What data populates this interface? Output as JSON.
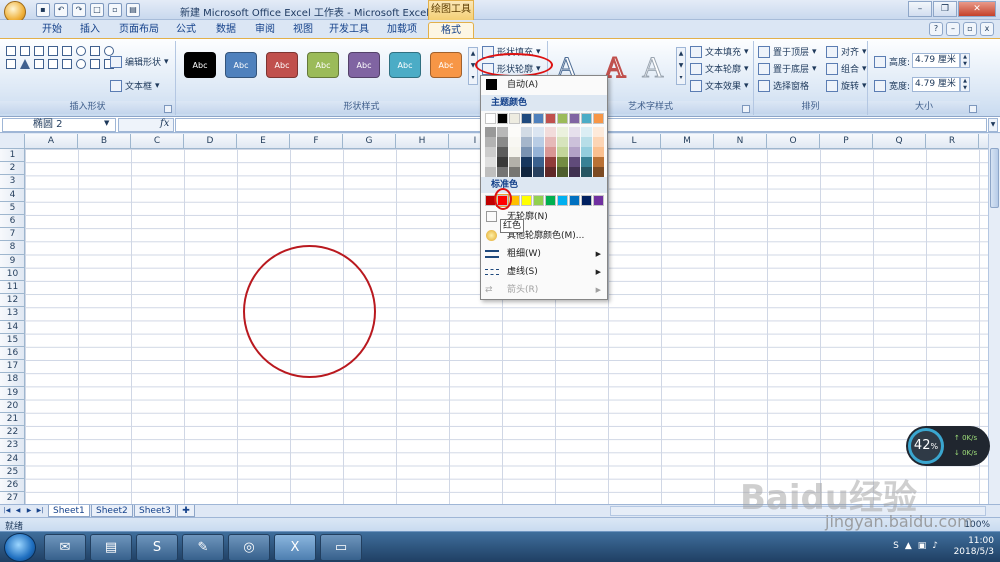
{
  "window": {
    "title": "新建 Microsoft Office Excel 工作表 - Microsoft Excel",
    "context_tool": "绘图工具"
  },
  "tabs": [
    "开始",
    "插入",
    "页面布局",
    "公式",
    "数据",
    "审阅",
    "视图",
    "开发工具",
    "加载项",
    "格式"
  ],
  "active_tab": "格式",
  "ribbon": {
    "insert_shapes": {
      "edit_shape": "编辑形状",
      "text_box": "文本框",
      "label": "插入形状"
    },
    "shape_styles": {
      "swatch_text": "Abc",
      "swatch_colors": [
        "#000000",
        "#4f81bd",
        "#c0504d",
        "#9bbb59",
        "#8064a2",
        "#4bacc6",
        "#f79646"
      ],
      "fill": "形状填充",
      "outline": "形状轮廓",
      "label": "形状样式"
    },
    "wordart": {
      "letter": "A",
      "text_fill": "文本填充",
      "text_outline": "文本轮廓",
      "text_effects": "文本效果",
      "label": "艺术字样式"
    },
    "arrange": {
      "bring_front": "置于顶层",
      "send_back": "置于底层",
      "selection_pane": "选择窗格",
      "align": "对齐",
      "group": "组合",
      "rotate": "旋转",
      "label": "排列"
    },
    "size": {
      "height_label": "高度:",
      "height_value": "4.79 厘米",
      "width_label": "宽度:",
      "width_value": "4.79 厘米",
      "label": "大小"
    }
  },
  "formula_bar": {
    "name_box": "椭圆 2",
    "fx": "fx",
    "content": ""
  },
  "columns": [
    "A",
    "B",
    "C",
    "D",
    "E",
    "F",
    "G",
    "H",
    "I",
    "J",
    "K",
    "L",
    "M",
    "N",
    "O",
    "P",
    "Q",
    "R"
  ],
  "rows": [
    "1",
    "2",
    "3",
    "4",
    "5",
    "6",
    "7",
    "8",
    "9",
    "10",
    "11",
    "12",
    "13",
    "14",
    "15",
    "16",
    "17",
    "18",
    "19",
    "20",
    "21",
    "22",
    "23",
    "24",
    "25",
    "26",
    "27"
  ],
  "shape": {
    "type": "circle",
    "outline_color": "#b9191f"
  },
  "outline_menu": {
    "automatic": "自动(A)",
    "theme_colors_header": "主题颜色",
    "theme_colors": [
      "#ffffff",
      "#000000",
      "#eeece1",
      "#1f497d",
      "#4f81bd",
      "#c0504d",
      "#9bbb59",
      "#8064a2",
      "#4bacc6",
      "#f79646"
    ],
    "standard_colors_header": "标准色",
    "standard_colors": [
      "#c00000",
      "#ff0000",
      "#ffc000",
      "#ffff00",
      "#92d050",
      "#00b050",
      "#00b0f0",
      "#0070c0",
      "#002060",
      "#7030a0"
    ],
    "no_outline": "无轮廓(N)",
    "more_colors": "其他轮廓颜色(M)...",
    "weight": "粗细(W)",
    "dashes": "虚线(S)",
    "arrows": "箭头(R)",
    "tooltip": "红色"
  },
  "sheets": [
    "Sheet1",
    "Sheet2",
    "Sheet3"
  ],
  "status": {
    "ready": "就绪",
    "zoom": "100%"
  },
  "taskbar": {
    "time": "11:00",
    "date": "2018/5/3"
  },
  "net_widget": {
    "percent": "42",
    "unit": "%",
    "up": "0K/s",
    "down": "0K/s"
  },
  "watermark": {
    "text": "Baidu经验",
    "url": "jingyan.baidu.com"
  }
}
